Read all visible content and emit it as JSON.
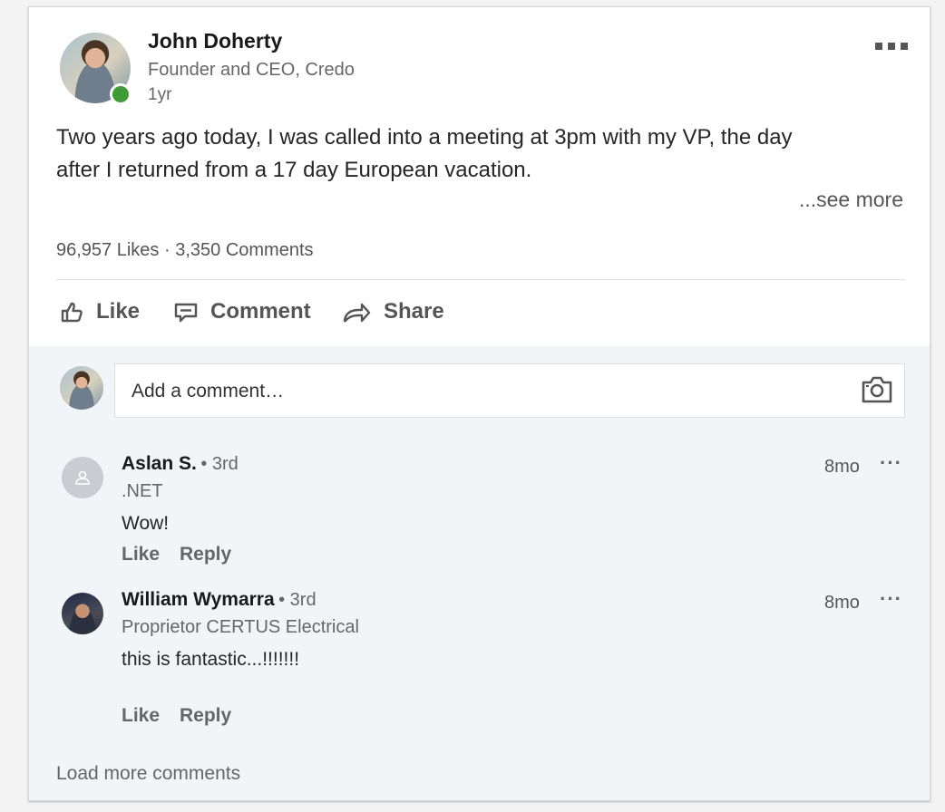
{
  "post": {
    "author_name": "John Doherty",
    "author_headline": "Founder and CEO, Credo",
    "time": "1yr",
    "more_menu": "▪▪▪",
    "text_line1": "Two years ago today, I was called into a meeting at 3pm with my VP, the day",
    "text_line2": "after I returned from a 17 day European vacation.",
    "see_more": "...see more",
    "likes": "96,957 Likes",
    "separator": "·",
    "comments_count": "3,350 Comments",
    "presence_color": "#3f9b34"
  },
  "actions": {
    "like": "Like",
    "comment": "Comment",
    "share": "Share"
  },
  "comment_box": {
    "placeholder": "Add a comment…"
  },
  "comments": [
    {
      "name": "Aslan S.",
      "degree": "• 3rd",
      "headline": ".NET",
      "text": "Wow!",
      "time": "8mo",
      "more": "···",
      "like": "Like",
      "reply": "Reply"
    },
    {
      "name": "William Wymarra",
      "degree": "• 3rd",
      "headline": "Proprietor CERTUS Electrical",
      "text": "this is fantastic...!!!!!!!",
      "time": "8mo",
      "more": "···",
      "like": "Like",
      "reply": "Reply"
    }
  ],
  "load_more": "Load more comments",
  "icons": [
    "like-icon",
    "comment-icon",
    "share-icon",
    "camera-icon",
    "person-placeholder-icon"
  ]
}
